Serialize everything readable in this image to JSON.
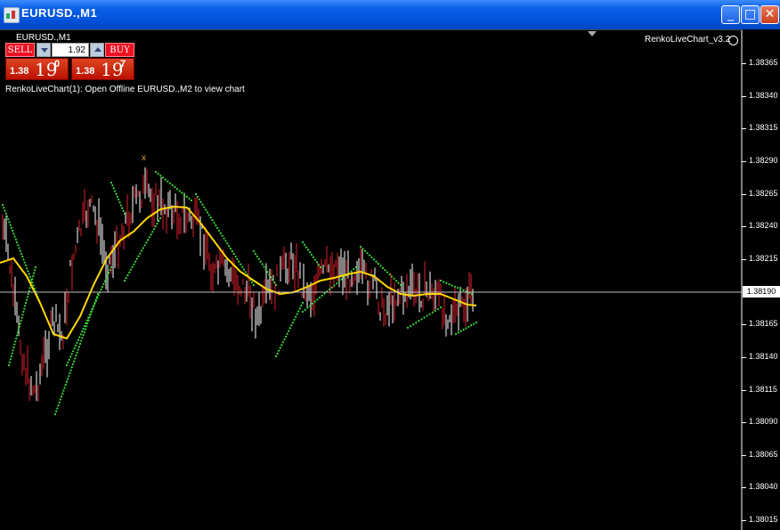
{
  "window": {
    "title": "EURUSD.,M1",
    "minimize_glyph": "_",
    "maximize_glyph": "□",
    "close_glyph": "✕"
  },
  "chart": {
    "label": "EURUSD.,M1",
    "indicator_name": "RenkoLiveChart_v3.2",
    "message": "RenkoLiveChart(1): Open Offline EURUSD.,M2 to view chart",
    "current_price": "1.38190",
    "marker": "x"
  },
  "trade_panel": {
    "sell_label": "SELL",
    "buy_label": "BUY",
    "lot_size": "1.92",
    "bid": {
      "prefix": "1.38",
      "big": "19",
      "sup": "0"
    },
    "ask": {
      "prefix": "1.38",
      "big": "19",
      "sup": "7"
    }
  },
  "price_axis": {
    "ticks": [
      "1.38365",
      "1.38340",
      "1.38315",
      "1.38290",
      "1.38265",
      "1.38240",
      "1.38215",
      "1.38165",
      "1.38140",
      "1.38115",
      "1.38090",
      "1.38065",
      "1.38040",
      "1.38015"
    ]
  },
  "colors": {
    "background": "#000000",
    "up_bar": "#ffffff",
    "down_bar": "#e0202a",
    "ma_line": "#ffd700",
    "trail_dots": "#3adf3a",
    "price_line": "#c0c0c0"
  }
}
